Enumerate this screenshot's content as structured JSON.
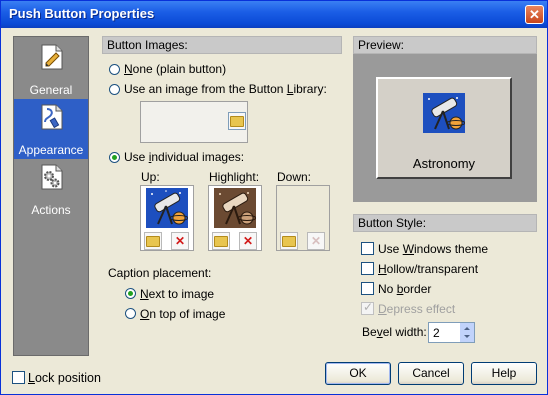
{
  "window": {
    "title": "Push Button Properties",
    "close_glyph": "✕"
  },
  "sidebar": {
    "items": [
      {
        "label": "General",
        "icon": "document-pencil-icon",
        "selected": false
      },
      {
        "label": "Appearance",
        "icon": "paintbrush-icon",
        "selected": true
      },
      {
        "label": "Actions",
        "icon": "gears-icon",
        "selected": false
      }
    ]
  },
  "button_images": {
    "header": "Button Images:",
    "options": [
      {
        "pre": "",
        "u": "N",
        "post": "one (plain button)",
        "selected": false
      },
      {
        "pre": "Use an image from the Button ",
        "u": "L",
        "post": "ibrary:",
        "selected": false
      },
      {
        "pre": "Use ",
        "u": "i",
        "post": "ndividual images:",
        "selected": true
      }
    ],
    "slots": [
      {
        "label": "Up:",
        "has_image": true
      },
      {
        "label": "Highlight:",
        "has_image": true
      },
      {
        "label": "Down:",
        "has_image": false
      }
    ]
  },
  "caption_placement": {
    "label": "Caption placement:",
    "options": [
      {
        "pre": "",
        "u": "N",
        "post": "ext to image",
        "selected": true
      },
      {
        "pre": "",
        "u": "O",
        "post": "n top of image",
        "selected": false
      }
    ]
  },
  "preview": {
    "header": "Preview:",
    "caption": "Astronomy"
  },
  "button_style": {
    "header": "Button Style:",
    "options": [
      {
        "pre": "Use ",
        "u": "W",
        "post": "indows theme",
        "checked": false,
        "disabled": false
      },
      {
        "pre": "",
        "u": "H",
        "post": "ollow/transparent",
        "checked": false,
        "disabled": false
      },
      {
        "pre": "No ",
        "u": "b",
        "post": "order",
        "checked": false,
        "disabled": false
      },
      {
        "pre": "",
        "u": "D",
        "post": "epress effect",
        "checked": true,
        "disabled": true
      }
    ],
    "bevel": {
      "pre": "Be",
      "u": "v",
      "post": "el width:",
      "value": "2"
    }
  },
  "footer": {
    "lock": {
      "pre": "",
      "u": "L",
      "post": "ock position",
      "checked": false
    },
    "buttons": {
      "ok": "OK",
      "cancel": "Cancel",
      "help": "Help"
    }
  },
  "colors": {
    "title_bar": "#0a4ad6",
    "sidebar_bg": "#8a8a8a",
    "sidebar_selected": "#2e5fc7",
    "dialog_bg": "#ece9d8"
  }
}
